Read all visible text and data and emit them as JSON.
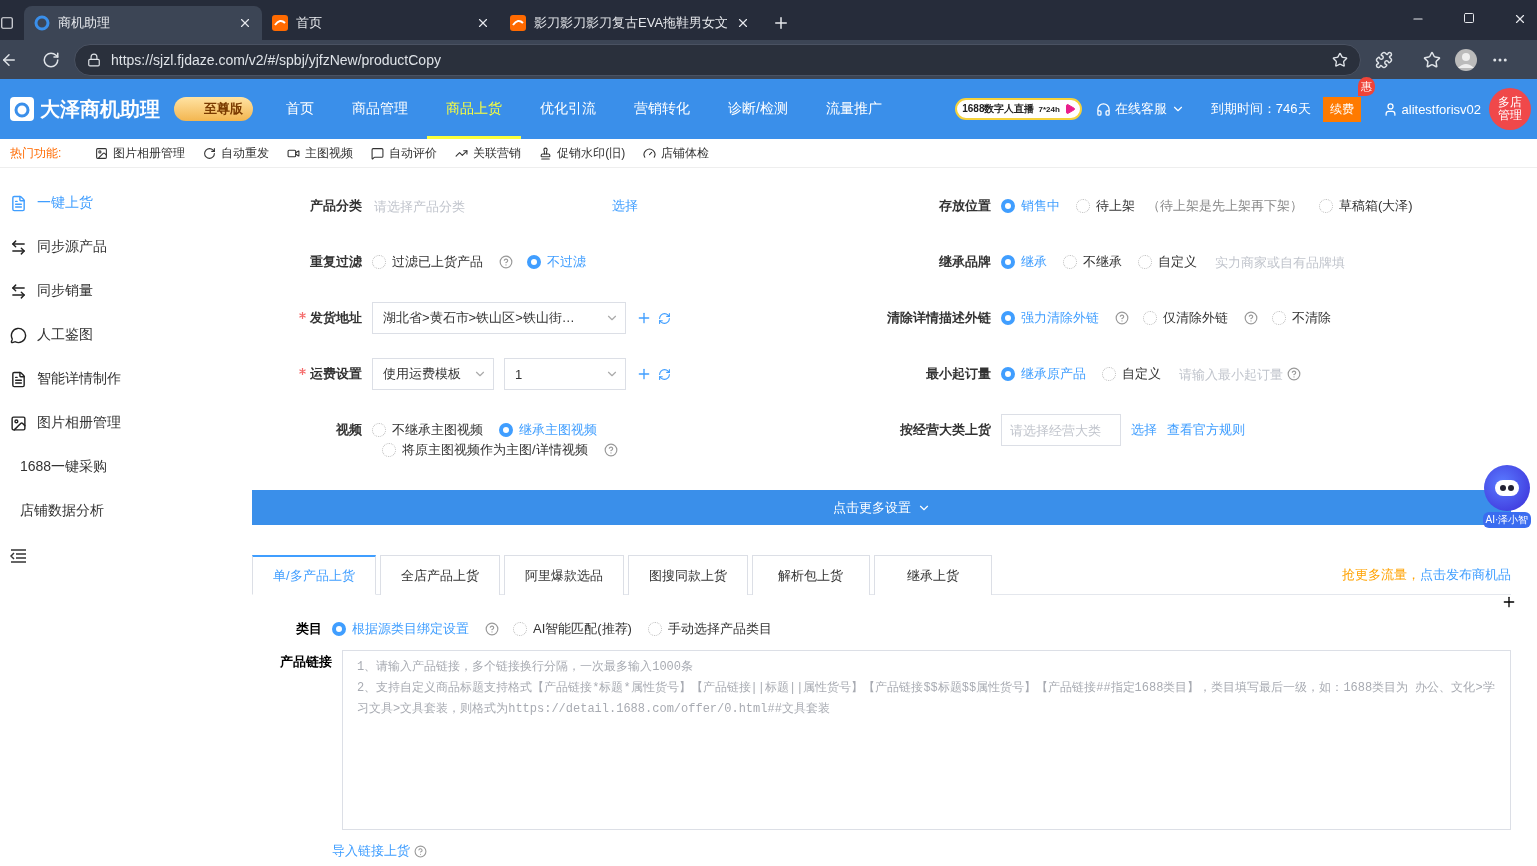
{
  "browser": {
    "tabs": [
      {
        "title": "商机助理",
        "selected": true,
        "kind": "app"
      },
      {
        "title": "首页",
        "selected": false,
        "kind": "ali"
      },
      {
        "title": "影刀影刀影刀复古EVA拖鞋男女文",
        "selected": false,
        "kind": "ali"
      }
    ],
    "url": "https://sjzl.fjdaze.com/v2/#/spbj/yjfzNew/productCopy"
  },
  "header": {
    "logo_text": "大泽商机助理",
    "edition": "至尊版",
    "nav": [
      {
        "label": "首页",
        "selected": false
      },
      {
        "label": "商品管理",
        "selected": false
      },
      {
        "label": "商品上货",
        "selected": true
      },
      {
        "label": "优化引流",
        "selected": false
      },
      {
        "label": "营销转化",
        "selected": false
      },
      {
        "label": "诊断/检测",
        "selected": false
      },
      {
        "label": "流量推广",
        "selected": false
      }
    ],
    "live": {
      "label": "1688数字人直播",
      "sub": "7*24h"
    },
    "service": "在线客服",
    "expiry": "到期时间：746天",
    "renew": "续费",
    "renew_badge": "惠",
    "user": "alitestforisv02",
    "multi_store": "多店管理"
  },
  "hot_bar": {
    "label": "热门功能:",
    "items": [
      "图片相册管理",
      "自动重发",
      "主图视频",
      "自动评价",
      "关联营销",
      "促销水印(旧)",
      "店铺体检"
    ]
  },
  "sidebar": {
    "items": [
      {
        "label": "一键上货",
        "selected": true,
        "icon": true
      },
      {
        "label": "同步源产品",
        "selected": false,
        "icon": true
      },
      {
        "label": "同步销量",
        "selected": false,
        "icon": true
      },
      {
        "label": "人工鉴图",
        "selected": false,
        "icon": true
      },
      {
        "label": "智能详情制作",
        "selected": false,
        "icon": true
      },
      {
        "label": "图片相册管理",
        "selected": false,
        "icon": true
      },
      {
        "label": "1688一键采购",
        "selected": false,
        "icon": false
      },
      {
        "label": "店铺数据分析",
        "selected": false,
        "icon": false
      }
    ]
  },
  "form": {
    "left": [
      {
        "label": "产品分类",
        "required": false,
        "kind": "picker",
        "placeholder": "请选择产品分类",
        "links": [
          "选择"
        ]
      },
      {
        "label": "重复过滤",
        "required": false,
        "kind": "radio",
        "options": [
          {
            "label": "过滤已上货产品",
            "selected": false,
            "help": true
          },
          {
            "label": "不过滤",
            "selected": true
          }
        ]
      },
      {
        "label": "发货地址",
        "required": true,
        "kind": "selects",
        "selects": [
          "湖北省>黄石市>铁山区>铁山街…"
        ]
      },
      {
        "label": "运费设置",
        "required": true,
        "kind": "selects",
        "selects": [
          "使用运费模板",
          "1"
        ]
      },
      {
        "label": "视频",
        "required": false,
        "kind": "radio",
        "options": [
          {
            "label": "不继承主图视频",
            "selected": false
          },
          {
            "label": "继承主图视频",
            "selected": true
          }
        ],
        "more_options": [
          {
            "label": "将原主图视频作为主图/详情视频",
            "selected": false,
            "help": true
          }
        ]
      }
    ],
    "right": [
      {
        "label": "存放位置",
        "required": false,
        "kind": "radio",
        "options": [
          {
            "label": "销售中",
            "selected": true
          },
          {
            "label": "待上架",
            "note": "（待上架是先上架再下架）",
            "selected": false
          },
          {
            "label": "草稿箱(大泽)",
            "selected": false
          }
        ]
      },
      {
        "label": "继承品牌",
        "required": false,
        "kind": "radio",
        "options": [
          {
            "label": "继承",
            "selected": true
          },
          {
            "label": "不继承",
            "selected": false
          },
          {
            "label": "自定义",
            "selected": false
          }
        ],
        "placeholder": "实力商家或自有品牌填"
      },
      {
        "label": "清除详情描述外链",
        "required": false,
        "kind": "radio",
        "options": [
          {
            "label": "强力清除外链",
            "selected": true,
            "help": true
          },
          {
            "label": "仅清除外链",
            "selected": false,
            "help": true
          },
          {
            "label": "不清除",
            "selected": false
          }
        ]
      },
      {
        "label": "最小起订量",
        "required": false,
        "kind": "radio",
        "options": [
          {
            "label": "继承原产品",
            "selected": true
          },
          {
            "label": "自定义",
            "selected": false
          }
        ],
        "placeholder": "请输入最小起订量",
        "help": true
      },
      {
        "label": "按经营大类上货",
        "required": false,
        "kind": "picker-box",
        "placeholder": "请选择经营大类",
        "links": [
          "选择",
          "查看官方规则"
        ]
      }
    ]
  },
  "more_settings": "点击更多设置",
  "tabs": [
    {
      "label": "单/多产品上货",
      "selected": true
    },
    {
      "label": "全店产品上货",
      "selected": false
    },
    {
      "label": "阿里爆款选品",
      "selected": false
    },
    {
      "label": "图搜同款上货",
      "selected": false
    },
    {
      "label": "解析包上货",
      "selected": false
    },
    {
      "label": "继承上货",
      "selected": false
    }
  ],
  "promo": {
    "text": "抢更多流量，",
    "link": "点击发布商机品"
  },
  "category": {
    "label": "类目",
    "options": [
      {
        "label": "根据源类目绑定设置",
        "selected": true,
        "help": true
      },
      {
        "label": "AI智能匹配(推荐)",
        "selected": false
      },
      {
        "label": "手动选择产品类目",
        "selected": false
      }
    ]
  },
  "links_field": {
    "label": "产品链接",
    "placeholder": "1、请输入产品链接，多个链接换行分隔，一次最多输入1000条\n2、支持自定义商品标题支持格式【产品链接*标题*属性货号】【产品链接||标题||属性货号】【产品链接$$标题$$属性货号】【产品链接##指定1688类目】，类目填写最后一级，如：1688类目为 办公、文化>学习文具>文具套装，则格式为https://detail.1688.com/offer/0.html##文具套装"
  },
  "import_link": "导入链接上货",
  "assistant": {
    "label": "AI·泽小智"
  }
}
